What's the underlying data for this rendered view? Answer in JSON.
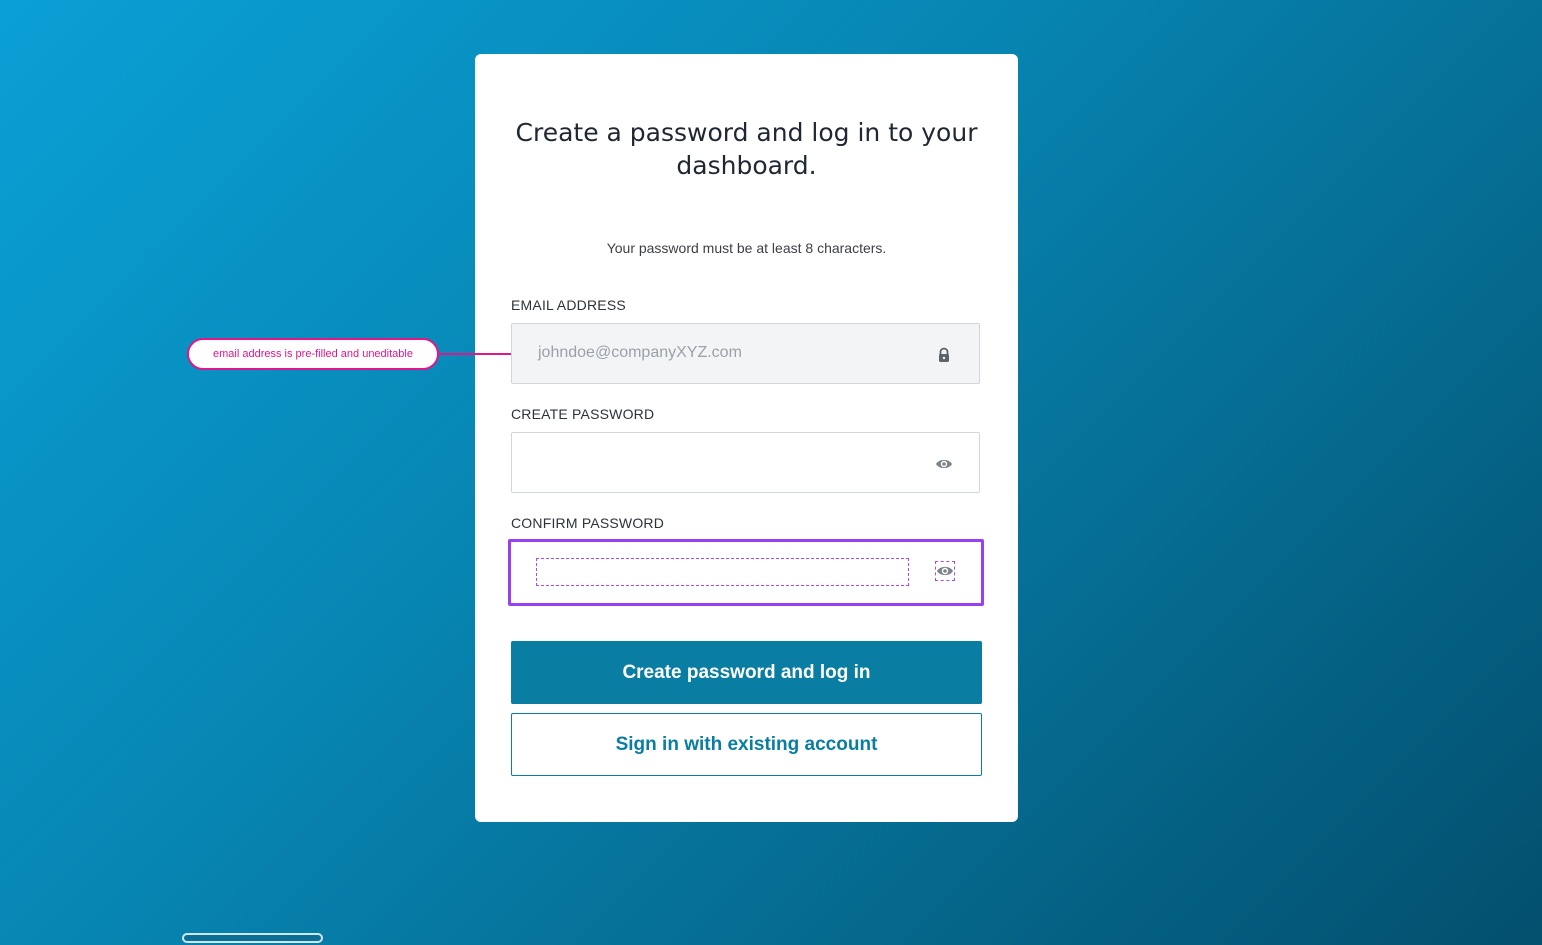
{
  "card": {
    "title": "Create a password and log in to your dashboard.",
    "hint": "Your password must be at least 8 characters."
  },
  "email": {
    "label": "EMAIL ADDRESS",
    "value": "johndoe@companyXYZ.com",
    "icon": "lock-icon"
  },
  "create_password": {
    "label": "CREATE PASSWORD",
    "value": "",
    "icon": "eye-icon"
  },
  "confirm_password": {
    "label": "CONFIRM PASSWORD",
    "value": "",
    "icon": "eye-icon",
    "highlight_color": "#9b3ff2"
  },
  "buttons": {
    "primary_label": "Create password and log in",
    "secondary_label": "Sign in with existing account",
    "accent_color": "#0a7da3"
  },
  "annotation": {
    "text": "email address is pre-filled and uneditable",
    "color": "#e0178b"
  }
}
